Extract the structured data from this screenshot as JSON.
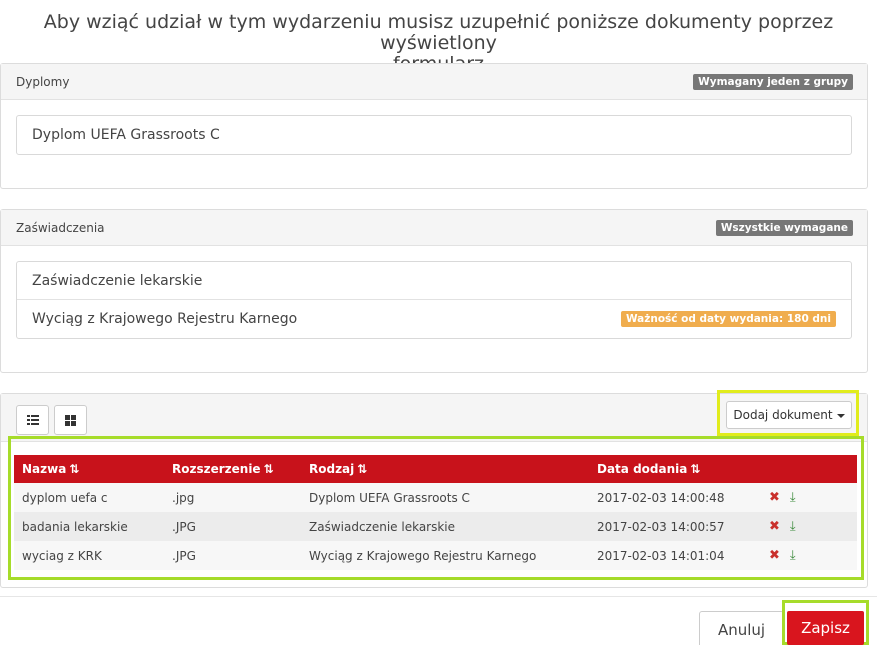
{
  "header": {
    "line1": "Aby wziąć udział w tym wydarzeniu musisz uzupełnić poniższe dokumenty poprzez wyświetlony",
    "line2": "formularz"
  },
  "diplomas": {
    "title": "Dyplomy",
    "badge": "Wymagany jeden z grupy",
    "items": [
      {
        "label": "Dyplom UEFA Grassroots C"
      }
    ]
  },
  "certificates": {
    "title": "Zaświadczenia",
    "badge": "Wszystkie wymagane",
    "items": [
      {
        "label": "Zaświadczenie lekarskie"
      },
      {
        "label": "Wyciąg z Krajowego Rejestru Karnego",
        "validity": "Ważność od daty wydania: 180 dni"
      }
    ]
  },
  "files": {
    "add_document_label": "Dodaj dokument",
    "columns": [
      "Nazwa",
      "Rozszerzenie",
      "Rodzaj",
      "Data dodania"
    ],
    "sort_glyph": "⇅",
    "rows": [
      {
        "name": "dyplom uefa c",
        "ext": ".jpg",
        "type": "Dyplom UEFA Grassroots C",
        "date": "2017-02-03 14:00:48"
      },
      {
        "name": "badania lekarskie",
        "ext": ".JPG",
        "type": "Zaświadczenie lekarskie",
        "date": "2017-02-03 14:00:57"
      },
      {
        "name": "wyciag z KRK",
        "ext": ".JPG",
        "type": "Wyciąg z Krajowego Rejestru Karnego",
        "date": "2017-02-03 14:01:04"
      }
    ],
    "delete_glyph": "✖",
    "download_glyph": "⤓"
  },
  "footer": {
    "cancel_label": "Anuluj",
    "save_label": "Zapisz"
  },
  "colors": {
    "table_header": "#c8121b",
    "save_button": "#d9151e",
    "highlight_green": "#a6dc2a",
    "highlight_yellow": "#e1ec1c",
    "validity_badge": "#f0ad4e"
  }
}
